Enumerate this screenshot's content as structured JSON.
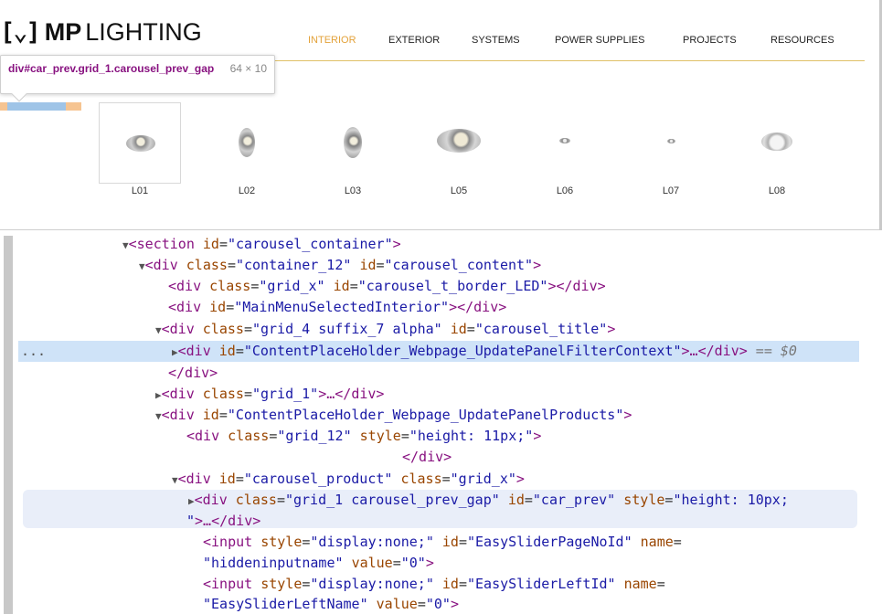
{
  "logo": {
    "mark": "[⌄]",
    "brand": "MP",
    "brand2": "LIGHTING"
  },
  "nav": [
    "INTERIOR",
    "EXTERIOR",
    "SYSTEMS",
    "POWER SUPPLIES",
    "PROJECTS",
    "RESOURCES"
  ],
  "tooltip": {
    "selector": "div#car_prev.grid_1.carousel_prev_gap",
    "size": "64 × 10"
  },
  "products": [
    "L01",
    "L02",
    "L03",
    "L05",
    "L06",
    "L07",
    "L08"
  ],
  "dom": {
    "l1": {
      "tag_open": "<section",
      "a1n": "id",
      "a1v": "\"carousel_container\"",
      "close": ">"
    },
    "l2": {
      "tag_open": "<div",
      "a1n": "class",
      "a1v": "\"container_12\"",
      "a2n": "id",
      "a2v": "\"carousel_content\"",
      "close": ">"
    },
    "l3": {
      "tag_open": "<div",
      "a1n": "class",
      "a1v": "\"grid_x\"",
      "a2n": "id",
      "a2v": "\"carousel_t_border_LED\"",
      "close": "></div>"
    },
    "l4": {
      "tag_open": "<div",
      "a1n": "id",
      "a1v": "\"MainMenuSelectedInterior\"",
      "close": "></div>"
    },
    "l5": {
      "tag_open": "<div",
      "a1n": "class",
      "a1v": "\"grid_4 suffix_7 alpha\"",
      "a2n": "id",
      "a2v": "\"carousel_title\"",
      "close": ">"
    },
    "l6": {
      "dots": "...",
      "tag_open": "<div",
      "a1n": "id",
      "a1v": "\"ContentPlaceHolder_Webpage_UpdatePanelFilterContext\"",
      "close": ">…</div>",
      "eq": " == $0"
    },
    "l7": {
      "close": "</div>"
    },
    "l8": {
      "tag_open": "<div",
      "a1n": "class",
      "a1v": "\"grid_1\"",
      "close": ">…</div>"
    },
    "l9": {
      "tag_open": "<div",
      "a1n": "id",
      "a1v": "\"ContentPlaceHolder_Webpage_UpdatePanelProducts\"",
      "close": ">"
    },
    "l10": {
      "tag_open": "<div",
      "a1n": "class",
      "a1v": "\"grid_12\"",
      "a2n": "style",
      "a2v": "\"height: 11px;\"",
      "close": ">"
    },
    "l11": {
      "close": "</div>"
    },
    "l12": {
      "tag_open": "<div",
      "a1n": "id",
      "a1v": "\"carousel_product\"",
      "a2n": "class",
      "a2v": "\"grid_x\"",
      "close": ">"
    },
    "l13": {
      "tag_open": "<div",
      "a1n": "class",
      "a1v": "\"grid_1 carousel_prev_gap\"",
      "a2n": "id",
      "a2v": "\"car_prev\"",
      "a3n": "style",
      "a3v": "\"height: 10px;"
    },
    "l14": {
      "a3v_end": "\"",
      "close": ">…</div>"
    },
    "l15": {
      "tag_open": "<input",
      "a1n": "style",
      "a1v": "\"display:none;\"",
      "a2n": "id",
      "a2v": "\"EasySliderPageNoId\"",
      "a3n": "name"
    },
    "l16": {
      "a3v": "\"hiddeninputname\"",
      "a4n": "value",
      "a4v": "\"0\"",
      "close": ">"
    },
    "l17": {
      "tag_open": "<input",
      "a1n": "style",
      "a1v": "\"display:none;\"",
      "a2n": "id",
      "a2v": "\"EasySliderLeftId\"",
      "a3n": "name"
    },
    "l18": {
      "a3v": "\"EasySliderLeftName\"",
      "a4n": "value",
      "a4v": "\"0\"",
      "close": ">"
    }
  },
  "colors": {
    "accent": "#e3a23a",
    "tag": "#881280",
    "attr_name": "#994500",
    "attr_value": "#1a1aa6",
    "selected_row": "#cfe3f8",
    "hover_row": "#e9eef9"
  }
}
